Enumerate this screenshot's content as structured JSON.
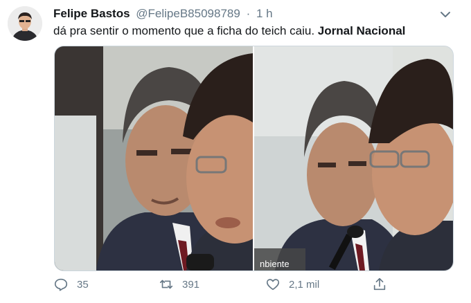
{
  "tweet": {
    "author_name": "Felipe Bastos",
    "author_handle": "@FelipeB85098789",
    "separator": "·",
    "time": "1 h",
    "text_plain": "dá pra sentir o momento que a ficha do teich caiu. ",
    "text_bold": "Jornal Nacional"
  },
  "media": {
    "caption_fragment": "nbiente"
  },
  "actions": {
    "reply_count": "35",
    "retweet_count": "391",
    "like_count": "2,1 mil"
  },
  "icons": {
    "caret": "chevron-down-icon",
    "reply": "reply-icon",
    "retweet": "retweet-icon",
    "like": "heart-icon",
    "share": "share-icon"
  },
  "colors": {
    "text_primary": "#14171a",
    "text_secondary": "#657786",
    "border": "#ccd6dd"
  }
}
